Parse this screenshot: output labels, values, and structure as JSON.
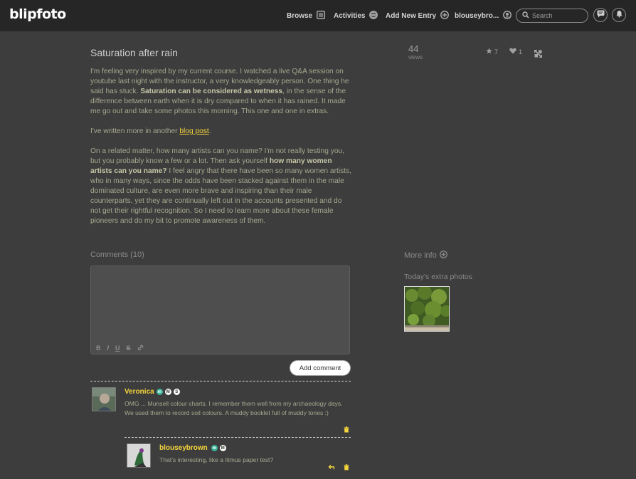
{
  "nav": {
    "logo": "blipfoto",
    "browse": "Browse",
    "activities": "Activities",
    "add_new_entry": "Add New Entry",
    "user": "blouseybro...",
    "search_placeholder": "Search"
  },
  "entry": {
    "title": "Saturation after rain",
    "p1_a": "I'm feeling very inspired by my current course. I watched a live Q&A session on youtube last night with the instructor, a very knowledgeably person. One thing he said has stuck. ",
    "p1_bold": "Saturation can be considered as wetness",
    "p1_b": ", in the sense of the difference between earth when it is dry compared to when it has rained. It made me go out and take some photos this morning. This one and one in extras.",
    "p2_a": "I've written more in another ",
    "p2_link": "blog post",
    "p2_b": ".",
    "p3_a": "On a related matter, how many artists can you name? I'm not really testing you, but you probably know a few or a lot. Then ask yourself ",
    "p3_bold": "how many women artists can you name?",
    "p3_b": " I feel angry that there have been so many women artists, who in many ways, since the odds have been stacked against them in the male dominated culture, are even more brave and inspiring than their male counterparts, yet they are continually left out in the accounts presented and do not get their rightful recognition. So I need to learn more about these female pioneers and do my bit to promote awareness of them."
  },
  "stats": {
    "views_count": "44",
    "views_label": "views",
    "stars": "7",
    "hearts": "1"
  },
  "comments": {
    "heading": "Comments (10)",
    "add_button": "Add comment",
    "format_buttons": [
      "B",
      "I",
      "U",
      "S",
      "🔗"
    ],
    "items": [
      {
        "name": "Veronica",
        "badges": [
          "m",
          "M",
          "S"
        ],
        "text": "OMG ... Munsell colour charts. I remember them well from my archaeology days. We used them to record soil colours. A muddy booklet full of muddy tones :)"
      },
      {
        "name": "blouseybrown",
        "badges": [
          "m",
          "M"
        ],
        "text": "That's interesting, like a litmus paper test?"
      }
    ]
  },
  "sidebar": {
    "more_info": "More info",
    "extra_photos": "Today's extra photos"
  },
  "colors": {
    "accent": "#f5d53c",
    "background": "#3d3d3d",
    "topbar": "#262626"
  }
}
